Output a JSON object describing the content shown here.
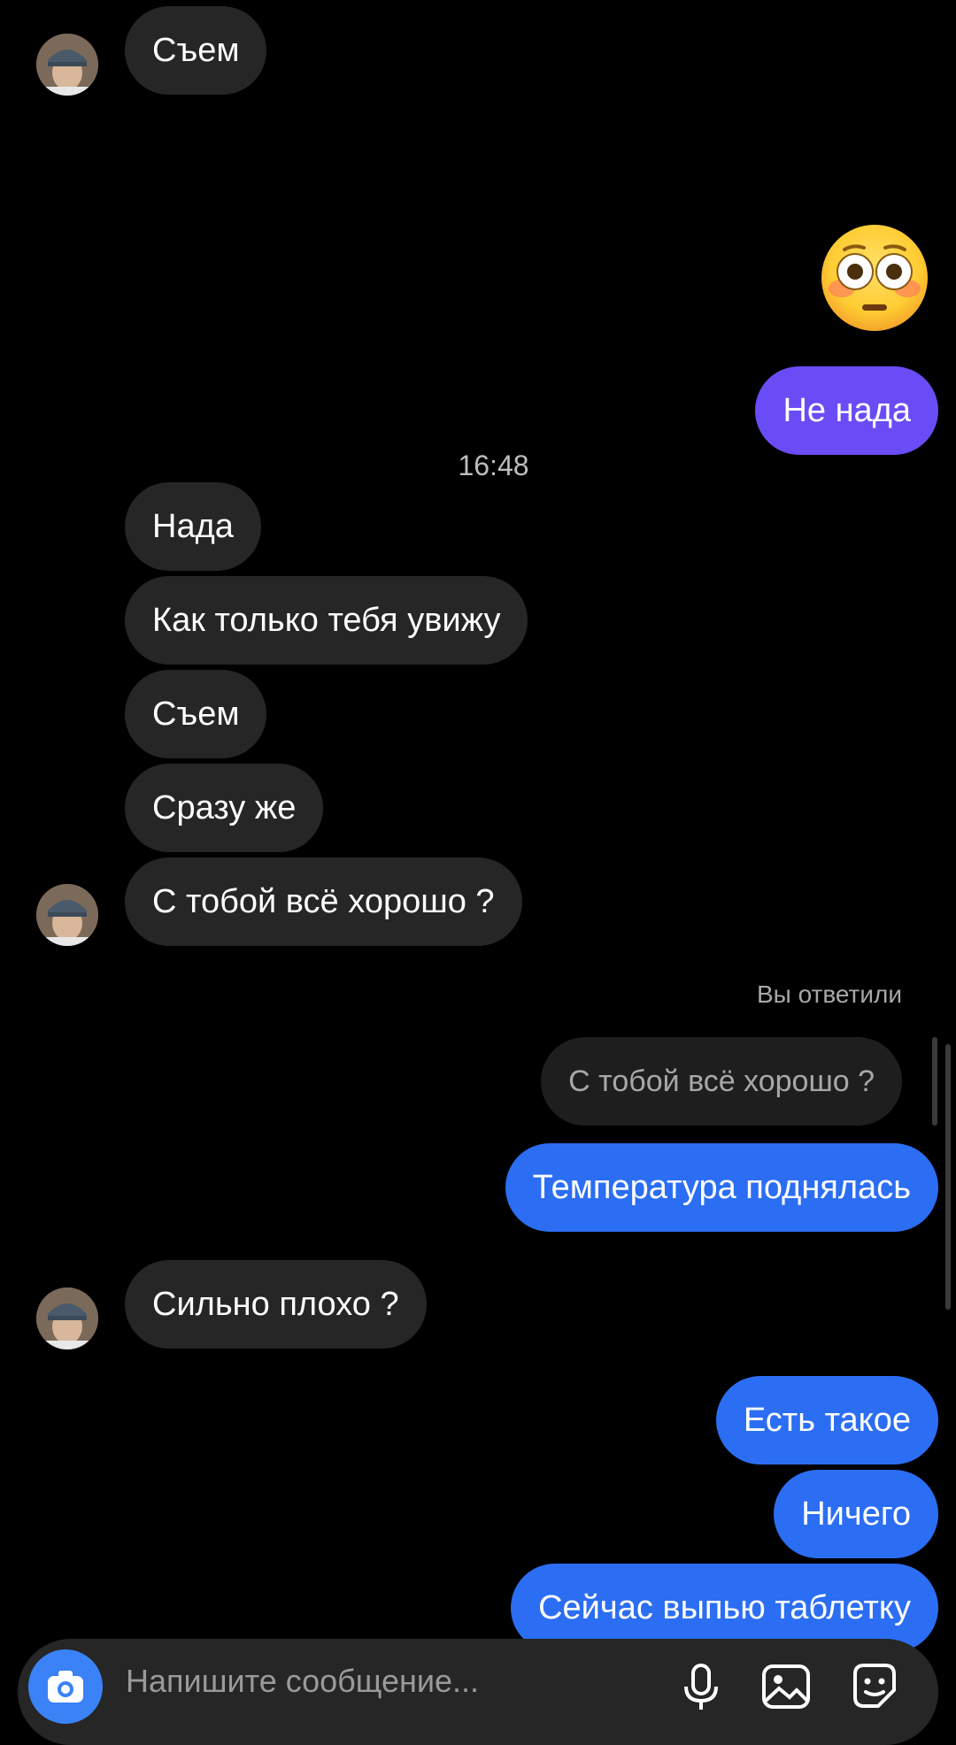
{
  "colors": {
    "background": "#000000",
    "incoming_bubble": "#262626",
    "outgoing_purple": "#6a4cf6",
    "outgoing_blue": "#2b6ef3"
  },
  "messages": {
    "m1": "Съем",
    "m2": "Не нада",
    "m3": "Нада",
    "m4": "Как только тебя увижу",
    "m5": "Съем",
    "m6": "Сразу же",
    "m7": "С тобой всё хорошо ?",
    "m8": "Температура поднялась",
    "m9": "Сильно плохо ?",
    "m10": "Есть такое",
    "m11": "Ничего",
    "m12": "Сейчас выпью таблетку"
  },
  "timestamp": "16:48",
  "reply": {
    "label": "Вы ответили",
    "quoted": "С тобой всё хорошо ?"
  },
  "sticker": {
    "icon": "flushed-face-emoji"
  },
  "composer": {
    "placeholder": "Напишите сообщение...",
    "icons": [
      "camera-icon",
      "microphone-icon",
      "gallery-icon",
      "sticker-icon"
    ]
  }
}
